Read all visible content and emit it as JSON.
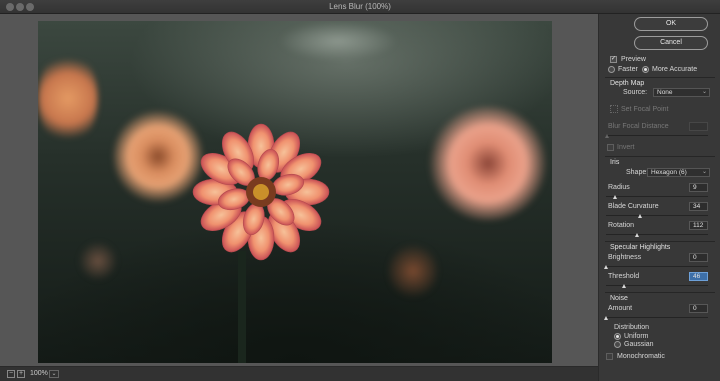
{
  "window": {
    "title": "Lens Blur (100%)"
  },
  "actions": {
    "ok": "OK",
    "cancel": "Cancel"
  },
  "preview": {
    "label": "Preview",
    "checked": true,
    "faster": "Faster",
    "more_accurate": "More Accurate",
    "mode": "More Accurate"
  },
  "depth_map": {
    "header": "Depth Map",
    "source_label": "Source:",
    "source_value": "None",
    "set_focal_point": "Set Focal Point",
    "blur_focal_distance_label": "Blur Focal Distance",
    "blur_focal_distance_value": "",
    "invert_label": "Invert"
  },
  "iris": {
    "header": "Iris",
    "shape_label": "Shape:",
    "shape_value": "Hexagon (6)",
    "radius_label": "Radius",
    "radius_value": "9",
    "radius_level": 0.09,
    "blade_label": "Blade Curvature",
    "blade_value": "34",
    "blade_level": 0.34,
    "rotation_label": "Rotation",
    "rotation_value": "112",
    "rotation_level": 0.31
  },
  "specular": {
    "header": "Specular Highlights",
    "brightness_label": "Brightness",
    "brightness_value": "0",
    "brightness_level": 0.0,
    "threshold_label": "Threshold",
    "threshold_value": "46",
    "threshold_level": 0.18
  },
  "noise": {
    "header": "Noise",
    "amount_label": "Amount",
    "amount_value": "0",
    "amount_level": 0.0,
    "distribution_label": "Distribution",
    "uniform": "Uniform",
    "gaussian": "Gaussian",
    "distribution_value": "Uniform",
    "monochromatic": "Monochromatic"
  },
  "zoom": {
    "minus": "−",
    "plus": "+",
    "level": "100%",
    "dropdown": "⌄"
  }
}
